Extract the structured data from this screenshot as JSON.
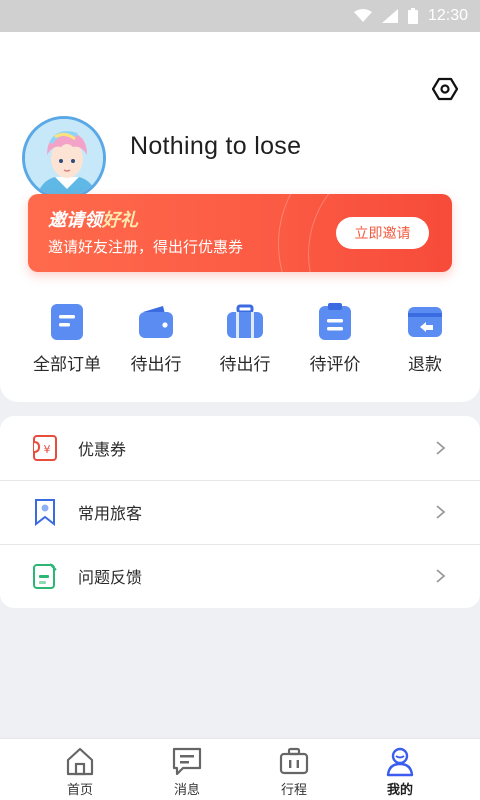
{
  "status_bar": {
    "time": "12:30",
    "icons": [
      "wifi-icon",
      "signal-icon",
      "battery-icon"
    ]
  },
  "profile": {
    "username": "Nothing to lose",
    "settings_icon": "hexagon-settings-icon",
    "avatar": "anime-avatar"
  },
  "invite": {
    "title_part1": "邀请领",
    "title_part2": "好礼",
    "subtitle": "邀请好友注册，得出行优惠券",
    "button": "立即邀请",
    "color": "#fb5a43"
  },
  "orders": [
    {
      "label": "全部订单",
      "icon": "order-list-icon"
    },
    {
      "label": "待出行",
      "icon": "wallet-icon"
    },
    {
      "label": "待出行",
      "icon": "suitcase-icon"
    },
    {
      "label": "待评价",
      "icon": "clipboard-icon"
    },
    {
      "label": "退款",
      "icon": "refund-icon"
    }
  ],
  "menu": [
    {
      "label": "优惠券",
      "icon": "coupon-icon"
    },
    {
      "label": "常用旅客",
      "icon": "bookmark-icon"
    },
    {
      "label": "问题反馈",
      "icon": "feedback-icon"
    }
  ],
  "nav": [
    {
      "label": "首页",
      "icon": "home-icon"
    },
    {
      "label": "消息",
      "icon": "message-icon"
    },
    {
      "label": "行程",
      "icon": "trip-icon"
    },
    {
      "label": "我的",
      "icon": "profile-icon",
      "active": true
    }
  ],
  "colors": {
    "accent": "#4a6cf7",
    "order_icon": "#5b8cf2",
    "banner": "#fb5a43"
  }
}
